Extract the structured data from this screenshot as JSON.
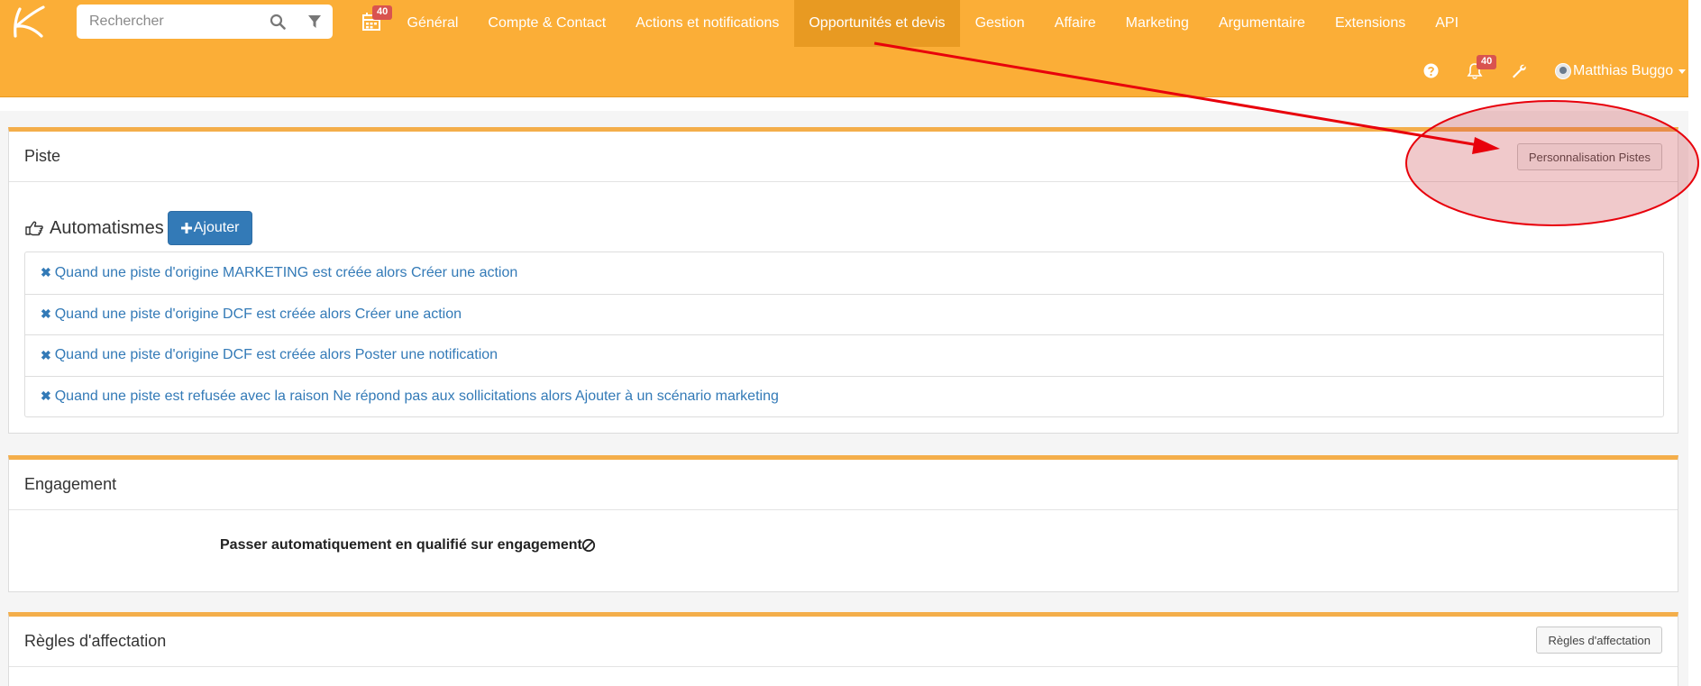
{
  "navbar": {
    "search_placeholder": "Rechercher",
    "calendar_badge": "40",
    "menu": [
      "Général",
      "Compte & Contact",
      "Actions et notifications",
      "Opportunités et devis",
      "Gestion",
      "Affaire",
      "Marketing",
      "Argumentaire",
      "Extensions",
      "API"
    ],
    "active_menu": "Opportunités et devis",
    "bell_badge": "40",
    "user_name": "Matthias Buggo"
  },
  "piste": {
    "title": "Piste",
    "customize_button": "Personnalisation Pistes",
    "automations_title": "Automatismes",
    "add_button": "Ajouter",
    "rules": [
      "Quand une piste d'origine MARKETING est créée alors Créer une action",
      "Quand une piste d'origine DCF est créée alors Créer une action",
      "Quand une piste d'origine DCF est créée alors Poster une notification",
      "Quand une piste est refusée avec la raison Ne répond pas aux sollicitations alors Ajouter à un scénario marketing"
    ]
  },
  "engagement": {
    "title": "Engagement",
    "setting_label": "Passer automatiquement en qualifié sur engagement"
  },
  "affectation": {
    "title": "Règles d'affectation",
    "button": "Règles d'affectation"
  },
  "colors": {
    "navbar": "#fbae37",
    "active_menu": "#e89a22",
    "panel_accent": "#f4ae4a",
    "link": "#337ab7",
    "badge": "#d9534f",
    "annotation": "#e8000b"
  }
}
